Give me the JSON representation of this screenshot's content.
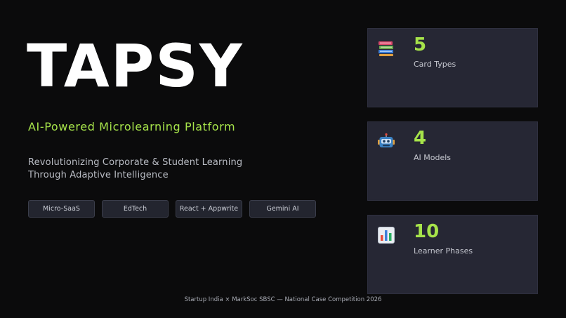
{
  "title": "TAPSY",
  "subtitle": "AI-Powered Microlearning Platform",
  "description": {
    "line1": "Revolutionizing Corporate & Student Learning",
    "line2": "Through Adaptive Intelligence"
  },
  "tags": [
    "Micro-SaaS",
    "EdTech",
    "React + Appwrite",
    "Gemini AI"
  ],
  "stats": [
    {
      "icon": "books-icon",
      "value": "5",
      "label": "Card Types"
    },
    {
      "icon": "robot-icon",
      "value": "4",
      "label": "AI Models"
    },
    {
      "icon": "bar-chart-icon",
      "value": "10",
      "label": "Learner Phases"
    }
  ],
  "footer": "Startup India × MarkSoc SBSC — National Case Competition 2026",
  "colors": {
    "background": "#0b0b0c",
    "accent": "#a6e34a",
    "card": "#262734",
    "tag": "#23252f"
  }
}
